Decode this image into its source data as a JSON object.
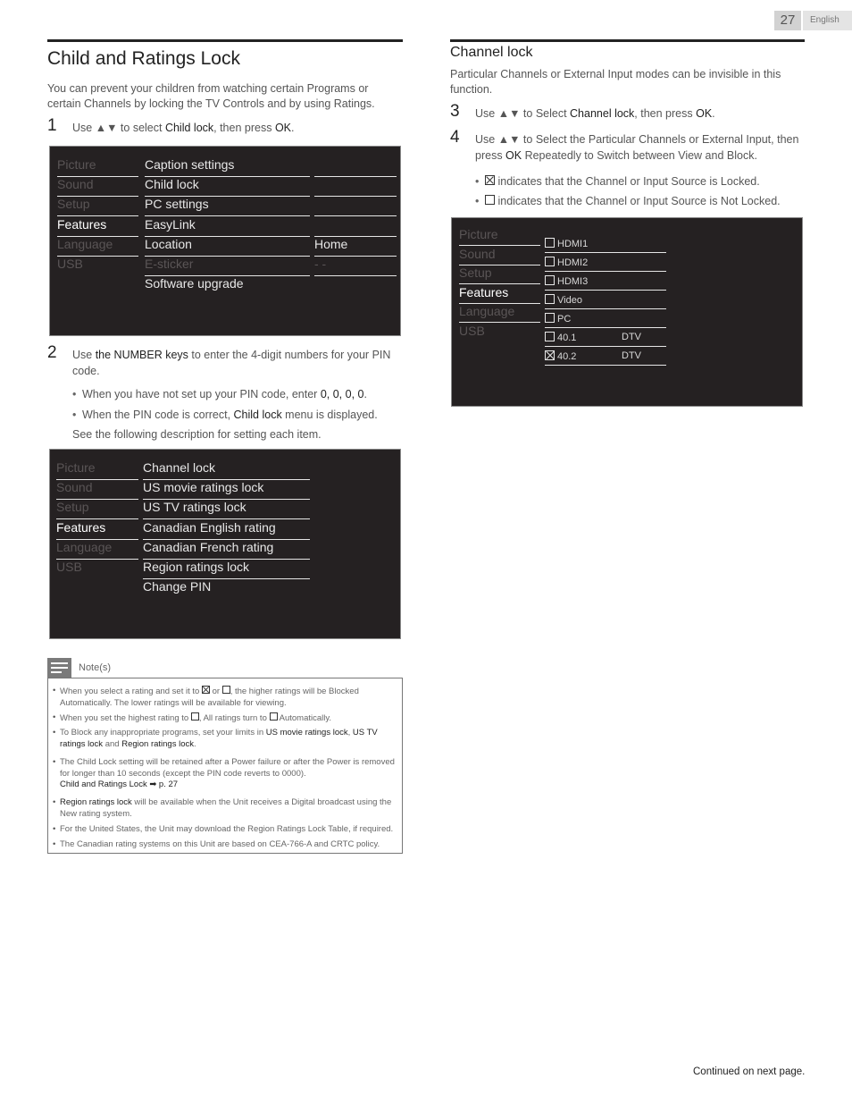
{
  "header": {
    "page_number": "27",
    "language": "English"
  },
  "left": {
    "title": "Child and Ratings Lock",
    "intro": "You can prevent your children from watching certain Programs or certain Channels by locking the TV Controls and by using Ratings.",
    "step1": {
      "num": "1",
      "pre": "Use ▲▼ to select ",
      "bold1": "Child lock",
      "mid": ", then press ",
      "bold2": "OK",
      "post": "."
    },
    "menu1": {
      "left_items": [
        {
          "label": "Picture",
          "active": false
        },
        {
          "label": "Sound",
          "active": false
        },
        {
          "label": "Setup",
          "active": false
        },
        {
          "label": "Features",
          "active": true
        },
        {
          "label": "Language",
          "active": false
        },
        {
          "label": "USB",
          "active": false
        }
      ],
      "sub_items": [
        {
          "label": "Caption settings",
          "value": "",
          "dim": false
        },
        {
          "label": "Child lock",
          "value": "",
          "dim": false
        },
        {
          "label": "PC settings",
          "value": "",
          "dim": false
        },
        {
          "label": "EasyLink",
          "value": "",
          "dim": false
        },
        {
          "label": "Location",
          "value": "Home",
          "dim": false
        },
        {
          "label": "E-sticker",
          "value": "- -",
          "dim": true
        },
        {
          "label": "Software upgrade",
          "value": "",
          "dim": false
        }
      ]
    },
    "step2": {
      "num": "2",
      "pre": "Use ",
      "bold1": "the NUMBER keys",
      "post": " to enter the 4-digit numbers for your PIN code.",
      "bullet1_pre": "When you have not set up your PIN code, enter ",
      "bullet1_bold": "0, 0, 0, 0",
      "bullet1_post": ".",
      "bullet2_pre": "When the PIN code is correct, ",
      "bullet2_bold": "Child lock",
      "bullet2_post": " menu is displayed.",
      "followup": "See the following description for setting each item."
    },
    "menu2": {
      "left_items": [
        {
          "label": "Picture",
          "active": false
        },
        {
          "label": "Sound",
          "active": false
        },
        {
          "label": "Setup",
          "active": false
        },
        {
          "label": "Features",
          "active": true
        },
        {
          "label": "Language",
          "active": false
        },
        {
          "label": "USB",
          "active": false
        }
      ],
      "sub_items": [
        "Channel lock",
        "US movie ratings lock",
        "US TV ratings lock",
        "Canadian English rating",
        "Canadian French rating",
        "Region ratings lock",
        "Change PIN"
      ]
    },
    "notes": {
      "label": "Note(s)",
      "n1_a": "When you select a rating and set it to ",
      "n1_b": " or ",
      "n1_c": ", the higher ratings will be Blocked Automatically. The lower ratings will be available for viewing.",
      "n2_a": "When you set the highest rating to ",
      "n2_b": ", All ratings turn to ",
      "n2_c": " Automatically.",
      "n3_a": "To Block any inappropriate programs, set your limits in ",
      "n3_b": "US movie ratings lock",
      "n3_c": ", ",
      "n3_d": "US TV ratings lock",
      "n3_e": " and ",
      "n3_f": "Region ratings lock",
      "n3_g": ".",
      "n4_a": "The Child Lock setting will be retained after a Power failure or after the Power is removed for longer than 10 seconds (except the PIN code reverts to 0000).",
      "n4_link": "Child and Ratings Lock ➡ p. 27",
      "n5_a": "Region ratings lock",
      "n5_b": " will be available when the Unit receives a Digital broadcast using the New rating system.",
      "n6": "For the United States, the Unit may download the Region Ratings Lock Table, if required.",
      "n7": "The Canadian rating systems on this Unit are based on CEA-766-A and CRTC policy."
    }
  },
  "right": {
    "subtitle": "Channel lock",
    "intro": "Particular Channels or External Input modes can be invisible in this function.",
    "step3": {
      "num": "3",
      "pre": "Use ▲▼ to Select ",
      "bold1": "Channel lock",
      "mid": ", then press ",
      "bold2": "OK",
      "post": "."
    },
    "step4": {
      "num": "4",
      "pre": "Use ▲▼ to Select the Particular Channels or External Input, then press ",
      "bold1": "OK",
      "post": " Repeatedly to Switch between View and Block."
    },
    "legend_locked": " indicates that the Channel or Input Source is Locked.",
    "legend_unlocked": " indicates that the Channel or Input Source is Not Locked.",
    "menu3": {
      "left_items": [
        {
          "label": "Picture",
          "active": false
        },
        {
          "label": "Sound",
          "active": false
        },
        {
          "label": "Setup",
          "active": false
        },
        {
          "label": "Features",
          "active": true
        },
        {
          "label": "Language",
          "active": false
        },
        {
          "label": "USB",
          "active": false
        }
      ],
      "channels": [
        {
          "label": "HDMI1",
          "type": "",
          "locked": false
        },
        {
          "label": "HDMI2",
          "type": "",
          "locked": false
        },
        {
          "label": "HDMI3",
          "type": "",
          "locked": false
        },
        {
          "label": "Video",
          "type": "",
          "locked": false
        },
        {
          "label": "PC",
          "type": "",
          "locked": false
        },
        {
          "label": "40.1",
          "type": "DTV",
          "locked": false
        },
        {
          "label": "40.2",
          "type": "DTV",
          "locked": true
        }
      ]
    }
  },
  "footer": {
    "continued": "Continued on next page."
  }
}
